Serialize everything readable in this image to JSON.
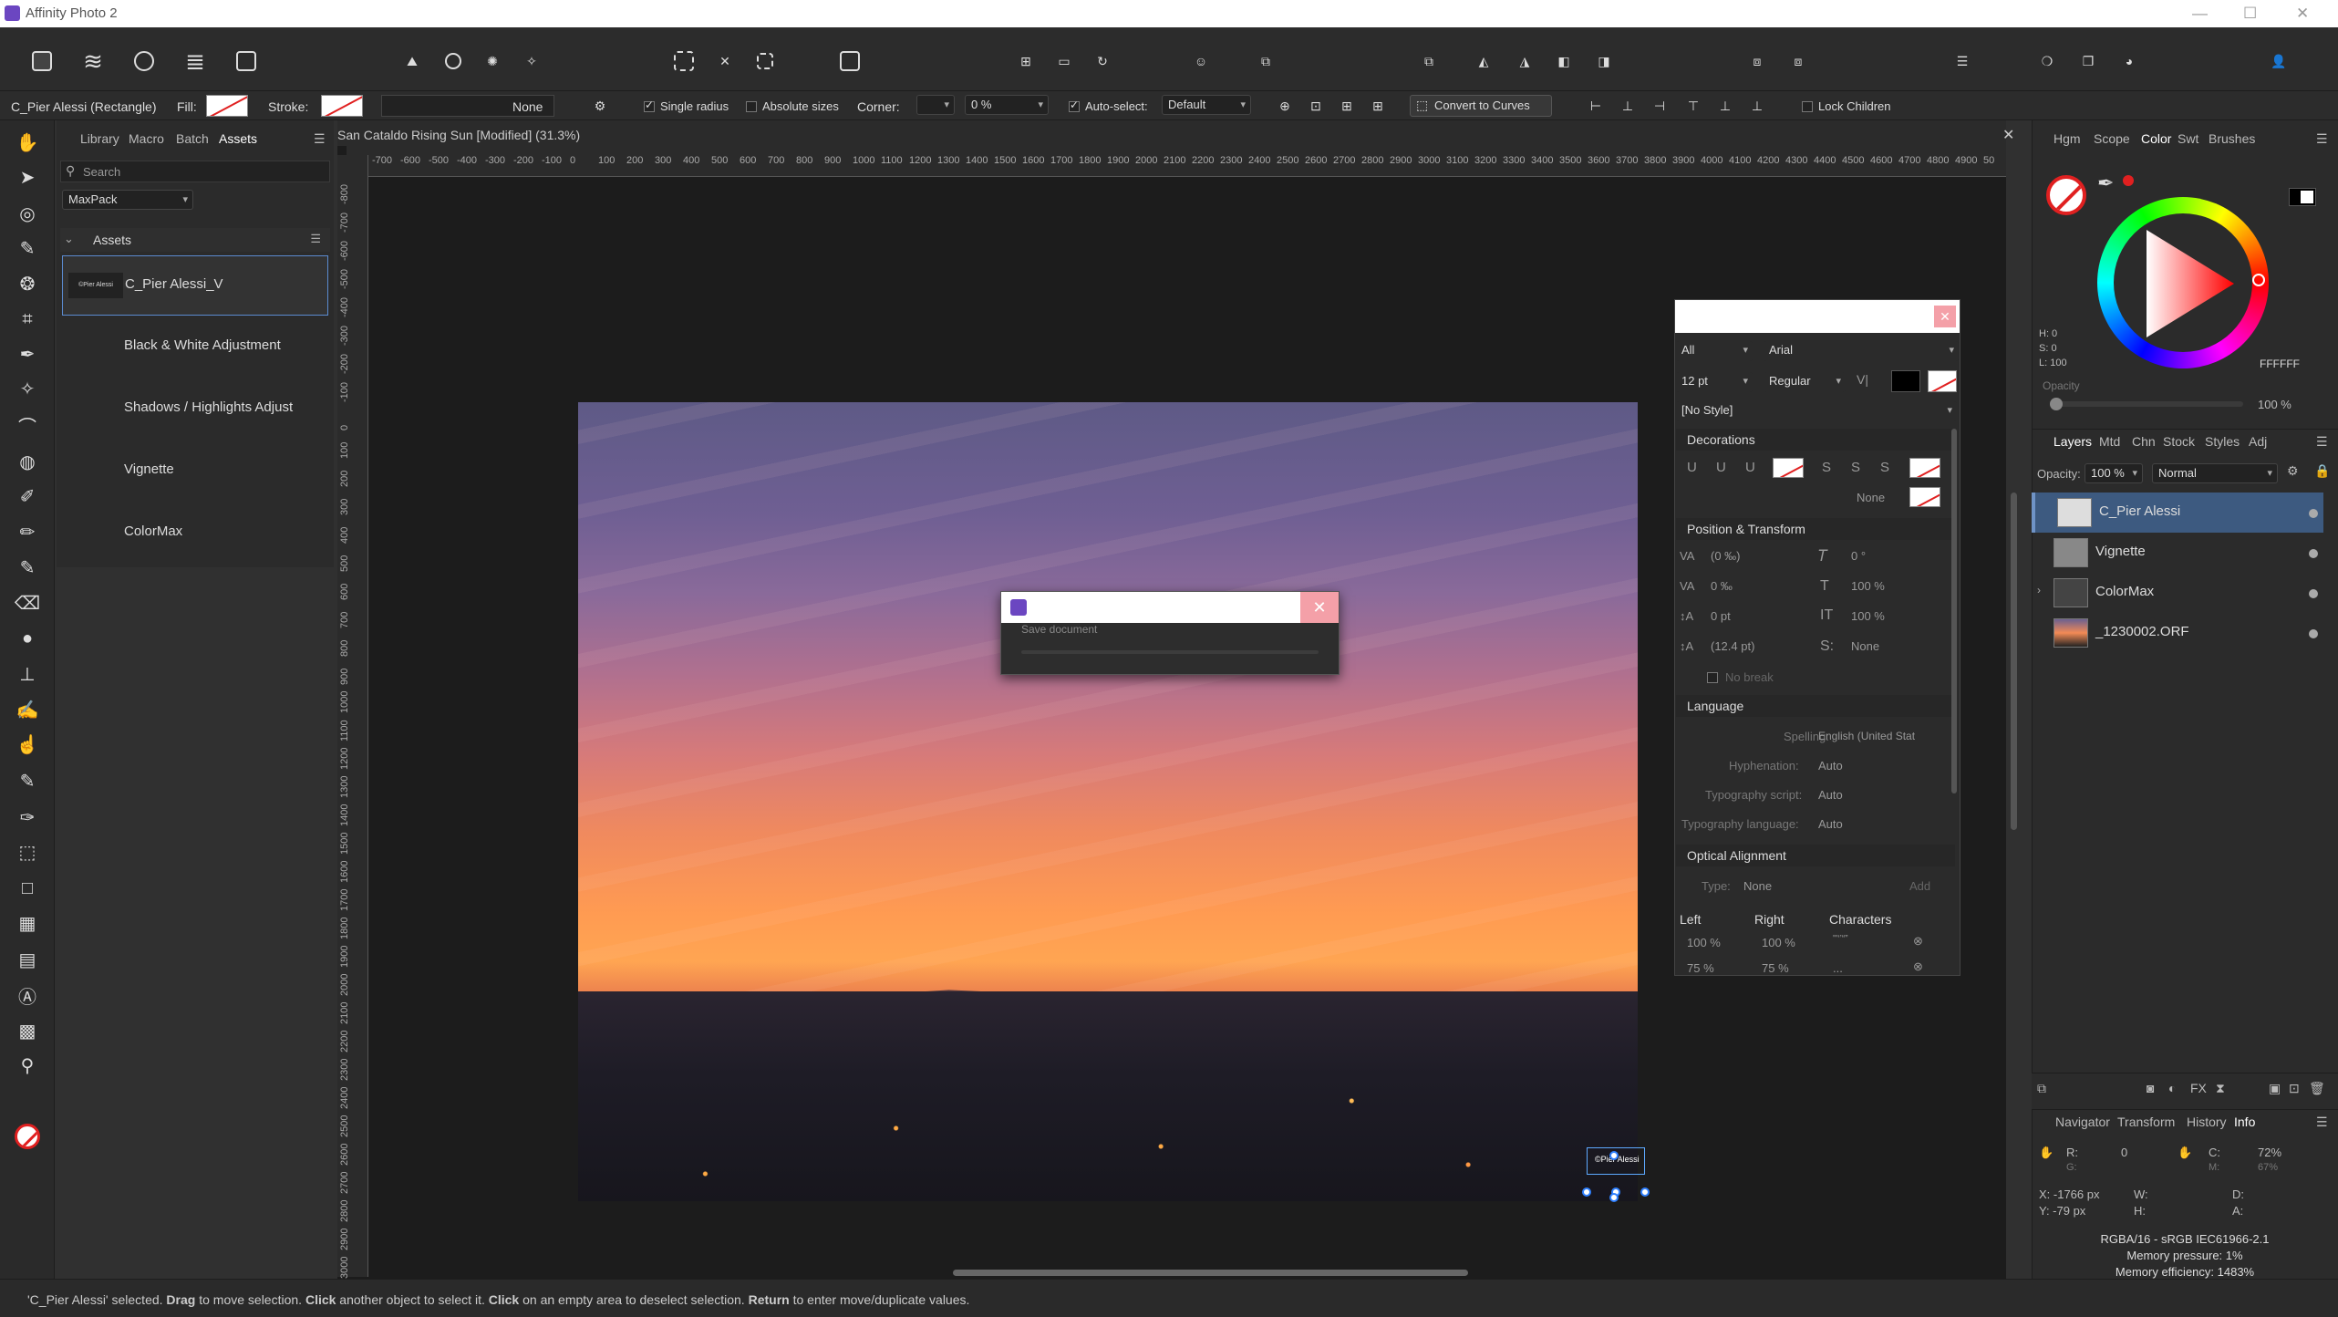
{
  "window": {
    "title": "Affinity Photo 2"
  },
  "context_toolbar": {
    "selection_label": "C_Pier Alessi (Rectangle)",
    "fill_label": "Fill:",
    "stroke_label": "Stroke:",
    "stroke_none": "None",
    "single_radius": "Single radius",
    "absolute_sizes": "Absolute sizes",
    "corner_label": "Corner:",
    "corner_value": "0 %",
    "auto_select_label": "Auto-select:",
    "auto_select_value": "Default",
    "convert_to_curves": "Convert to Curves",
    "lock_children": "Lock Children"
  },
  "left_panel": {
    "tabs": [
      "Library",
      "Macro",
      "Batch",
      "Assets"
    ],
    "search_placeholder": "Search",
    "category": "MaxPack",
    "section_title": "Assets",
    "assets": [
      {
        "thumb_text": "©Pier Alessi",
        "label": "C_Pier Alessi_V"
      },
      {
        "label": "Black & White Adjustment"
      },
      {
        "label": "Shadows / Highlights Adjust"
      },
      {
        "label": "Vignette"
      },
      {
        "label": "ColorMax"
      }
    ]
  },
  "document": {
    "title": "San Cataldo Rising Sun [Modified] (31.3%)",
    "ruler_h": [
      "-700",
      "-600",
      "-500",
      "-400",
      "-300",
      "-200",
      "-100",
      "0",
      "100",
      "200",
      "300",
      "400",
      "500",
      "600",
      "700",
      "800",
      "900",
      "1000",
      "1100",
      "1200",
      "1300",
      "1400",
      "1500",
      "1600",
      "1700",
      "1800",
      "1900",
      "2000",
      "2100",
      "2200",
      "2300",
      "2400",
      "2500",
      "2600",
      "2700",
      "2800",
      "2900",
      "3000",
      "3100",
      "3200",
      "3300",
      "3400",
      "3500",
      "3600",
      "3700",
      "3800",
      "3900",
      "4000",
      "4100",
      "4200",
      "4300",
      "4400",
      "4500",
      "4600",
      "4700",
      "4800",
      "4900",
      "50"
    ],
    "ruler_v": [
      "-800",
      "-700",
      "-600",
      "-500",
      "-400",
      "-300",
      "-200",
      "-100",
      "0",
      "100",
      "200",
      "300",
      "400",
      "500",
      "600",
      "700",
      "800",
      "900",
      "1000",
      "1100",
      "1200",
      "1300",
      "1400",
      "1500",
      "1600",
      "1700",
      "1800",
      "1900",
      "2000",
      "2100",
      "2200",
      "2300",
      "2400",
      "2500",
      "2600",
      "2700",
      "2800",
      "2900",
      "3000"
    ],
    "selection_text": "©Pier Alessi"
  },
  "save_dialog": {
    "text": "Save document",
    "close": "✕"
  },
  "character_panel": {
    "close": "✕",
    "font_collection": "All",
    "font": "Arial",
    "size": "12 pt",
    "weight": "Regular",
    "style": "[No Style]",
    "sections": {
      "decorations": "Decorations",
      "position": "Position & Transform",
      "language": "Language",
      "optical": "Optical Alignment"
    },
    "decor_none": "None",
    "pos": {
      "tracking": "(0 ‰)",
      "kerning": "0 ‰",
      "baseline": "0 pt",
      "leading": "(12.4 pt)",
      "shear": "0 °",
      "scale_v": "100 %",
      "scale_h": "100 %",
      "caps": "None",
      "nobreak": "No break"
    },
    "lang": {
      "spelling_label": "Spelling:",
      "spelling": "English (United Stat",
      "hyph_label": "Hyphenation:",
      "hyph": "Auto",
      "script_label": "Typography script:",
      "script": "Auto",
      "tlang_label": "Typography language:",
      "tlang": "Auto"
    },
    "optical": {
      "type_label": "Type:",
      "type": "None",
      "add": "Add",
      "cols": [
        "Left",
        "Right",
        "Characters"
      ],
      "rows": [
        [
          "100 %",
          "100 %",
          "\"'‘’“”"
        ],
        [
          "75 %",
          "75 %",
          "..."
        ]
      ]
    }
  },
  "right_panel": {
    "top_tabs": [
      "Hgm",
      "Scope",
      "Color",
      "Swt",
      "Brushes"
    ],
    "color": {
      "h": "H: 0",
      "s": "S: 0",
      "l": "L: 100",
      "hex": "FFFFFF",
      "opacity_label": "Opacity",
      "opacity": "100 %",
      "accent": "#e03030"
    },
    "layer_tabs": [
      "Layers",
      "Mtd",
      "Chn",
      "Stock",
      "Styles",
      "Adj"
    ],
    "opacity_label": "Opacity:",
    "opacity": "100 %",
    "blend": "Normal",
    "layers": [
      "C_Pier Alessi",
      "Vignette",
      "ColorMax",
      "_1230002.ORF"
    ],
    "bottom_tabs": [
      "Navigator",
      "Transform",
      "History",
      "Info"
    ],
    "info": {
      "r": "R:",
      "r_val": "0",
      "g": "G:",
      "c": "C:",
      "c_val": "72%",
      "m": "M:",
      "m_val": "67%",
      "x": "X: -1766 px",
      "y": "Y: -79 px",
      "w": "W:",
      "h": "H:",
      "d": "D:",
      "a": "A:",
      "profile": "RGBA/16 - sRGB IEC61966-2.1",
      "mem_pressure": "Memory pressure: 1%",
      "mem_eff": "Memory efficiency: 1483%"
    }
  },
  "status": {
    "p1": "'C_Pier Alessi' selected. ",
    "b1": "Drag",
    "p2": " to move selection. ",
    "b2": "Click",
    "p3": " another object to select it. ",
    "b3": "Click",
    "p4": " on an empty area to deselect selection. ",
    "b4": "Return",
    "p5": " to enter move/duplicate values."
  }
}
